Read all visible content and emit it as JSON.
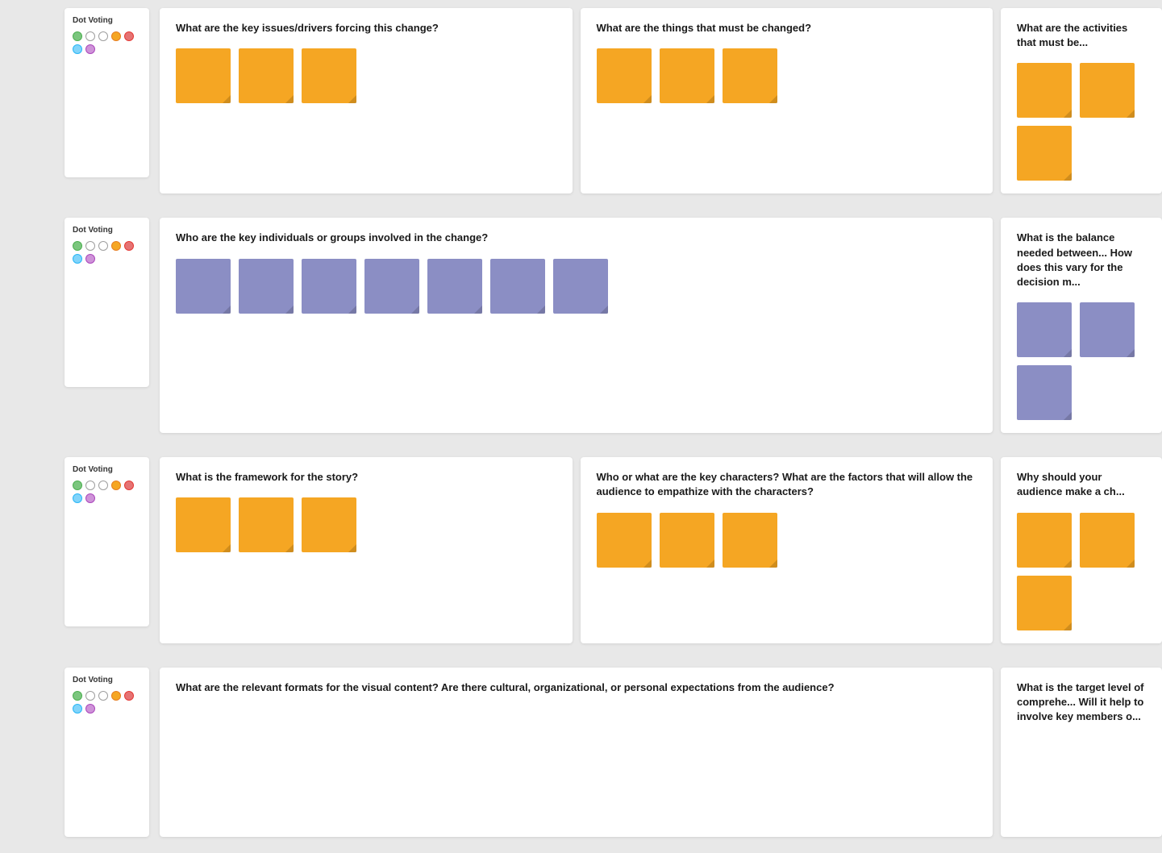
{
  "rows": [
    {
      "id": "row1",
      "dotVoting": {
        "label": "Dot Voting",
        "dots": [
          {
            "color": "#7BC67E",
            "borderColor": "#4CAF50"
          },
          {
            "color": "transparent",
            "borderColor": "#9E9E9E"
          },
          {
            "color": "transparent",
            "borderColor": "#9E9E9E"
          },
          {
            "color": "#F5A623",
            "borderColor": "#E67E22"
          },
          {
            "color": "#E57373",
            "borderColor": "#E53935"
          },
          {
            "color": "#81D4FA",
            "borderColor": "#29B6F6"
          },
          {
            "color": "#CE93D8",
            "borderColor": "#AB47BC"
          }
        ]
      },
      "panels": [
        {
          "title": "What are the key issues/drivers forcing this change?",
          "notes": [
            {
              "type": "orange"
            },
            {
              "type": "orange"
            },
            {
              "type": "orange"
            }
          ],
          "flex": 1
        },
        {
          "title": "What are the things that must be changed?",
          "notes": [
            {
              "type": "orange"
            },
            {
              "type": "orange"
            },
            {
              "type": "orange"
            }
          ],
          "flex": 1
        },
        {
          "title": "What are the activities that must be...",
          "notes": [
            {
              "type": "orange"
            },
            {
              "type": "orange"
            },
            {
              "type": "orange"
            }
          ],
          "flex": 1,
          "partial": true
        }
      ]
    },
    {
      "id": "row2",
      "dotVoting": {
        "label": "Dot Voting",
        "dots": [
          {
            "color": "#7BC67E",
            "borderColor": "#4CAF50"
          },
          {
            "color": "transparent",
            "borderColor": "#9E9E9E"
          },
          {
            "color": "transparent",
            "borderColor": "#9E9E9E"
          },
          {
            "color": "#F5A623",
            "borderColor": "#E67E22"
          },
          {
            "color": "#E57373",
            "borderColor": "#E53935"
          },
          {
            "color": "#81D4FA",
            "borderColor": "#29B6F6"
          },
          {
            "color": "#CE93D8",
            "borderColor": "#AB47BC"
          }
        ]
      },
      "panels": [
        {
          "title": "Who are the key individuals or groups involved in the change?",
          "notes": [
            {
              "type": "purple"
            },
            {
              "type": "purple"
            },
            {
              "type": "purple"
            },
            {
              "type": "purple"
            },
            {
              "type": "purple"
            },
            {
              "type": "purple"
            },
            {
              "type": "purple"
            }
          ],
          "flex": 2
        },
        {
          "title": "What is the balance needed between... How does this vary for the decision m...",
          "notes": [
            {
              "type": "purple"
            },
            {
              "type": "purple"
            },
            {
              "type": "purple"
            }
          ],
          "flex": 1,
          "partial": true
        }
      ]
    },
    {
      "id": "row3",
      "dotVoting": {
        "label": "Dot Voting",
        "dots": [
          {
            "color": "#7BC67E",
            "borderColor": "#4CAF50"
          },
          {
            "color": "transparent",
            "borderColor": "#9E9E9E"
          },
          {
            "color": "transparent",
            "borderColor": "#9E9E9E"
          },
          {
            "color": "#F5A623",
            "borderColor": "#E67E22"
          },
          {
            "color": "#E57373",
            "borderColor": "#E53935"
          },
          {
            "color": "#81D4FA",
            "borderColor": "#29B6F6"
          },
          {
            "color": "#CE93D8",
            "borderColor": "#AB47BC"
          }
        ]
      },
      "panels": [
        {
          "title": "What is the framework for the story?",
          "notes": [
            {
              "type": "orange"
            },
            {
              "type": "orange"
            },
            {
              "type": "orange"
            }
          ],
          "flex": 1
        },
        {
          "title": "Who or what are the key characters? What are the factors that will allow the audience to empathize with the characters?",
          "notes": [
            {
              "type": "orange"
            },
            {
              "type": "orange"
            },
            {
              "type": "orange"
            }
          ],
          "flex": 1
        },
        {
          "title": "Why should your audience make a ch...",
          "notes": [
            {
              "type": "orange"
            },
            {
              "type": "orange"
            },
            {
              "type": "orange"
            }
          ],
          "flex": 1,
          "partial": true
        }
      ]
    },
    {
      "id": "row4",
      "dotVoting": {
        "label": "Dot Voting",
        "dots": [
          {
            "color": "#7BC67E",
            "borderColor": "#4CAF50"
          },
          {
            "color": "transparent",
            "borderColor": "#9E9E9E"
          },
          {
            "color": "transparent",
            "borderColor": "#9E9E9E"
          },
          {
            "color": "#F5A623",
            "borderColor": "#E67E22"
          },
          {
            "color": "#E57373",
            "borderColor": "#E53935"
          },
          {
            "color": "#81D4FA",
            "borderColor": "#29B6F6"
          },
          {
            "color": "#CE93D8",
            "borderColor": "#AB47BC"
          }
        ]
      },
      "panels": [
        {
          "title": "What are the relevant formats for the visual content? Are there cultural, organizational, or personal expectations from the audience?",
          "notes": [],
          "flex": 2
        },
        {
          "title": "What is the target level of comprehe... Will it help to involve key members o...",
          "notes": [],
          "flex": 1,
          "partial": true
        }
      ]
    }
  ],
  "colors": {
    "orange": "#F5A623",
    "purple": "#8B8EC4",
    "background": "#e8e8e8",
    "panelBg": "#ffffff",
    "titleColor": "#1a1a1a"
  }
}
